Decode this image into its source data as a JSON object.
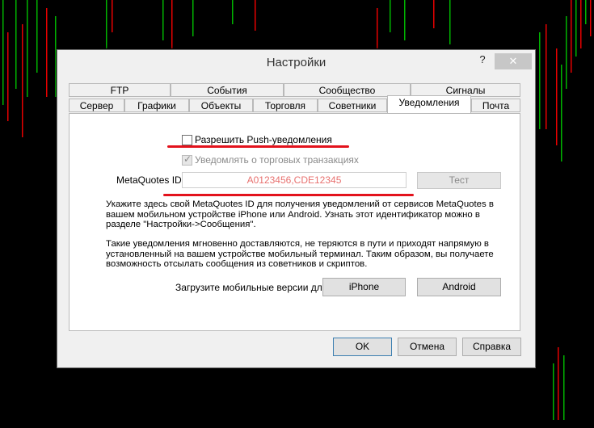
{
  "dialog": {
    "title": "Настройки",
    "help_label": "?",
    "close_label": "✕"
  },
  "tabs_row1": [
    "FTP",
    "События",
    "Сообщество",
    "Сигналы"
  ],
  "tabs_row2": [
    "Сервер",
    "Графики",
    "Объекты",
    "Торговля",
    "Советники",
    "Уведомления",
    "Почта"
  ],
  "notifications": {
    "enable_push_label": "Разрешить Push-уведомления",
    "enable_push_checked": false,
    "trade_notify_label": "Уведомлять о торговых транзакциях",
    "trade_notify_checked": true,
    "metaquotes_label": "MetaQuotes ID:",
    "metaquotes_value": "A0123456,CDE12345",
    "test_button": "Тест",
    "info_text_1": "Укажите здесь свой MetaQuotes ID для получения уведомлений от сервисов MetaQuotes в вашем мобильном устройстве iPhone или Android. Узнать этот идентификатор можно в разделе \"Настройки->Сообщения\".",
    "info_text_2": "Такие уведомления мгновенно доставляются, не теряются в пути и приходят напрямую в установленный на вашем устройстве мобильный терминал. Таким образом, вы получаете возможность отсылать сообщения из советников и скриптов.",
    "download_label": "Загрузите мобильные версии для:",
    "iphone_button": "iPhone",
    "android_button": "Android"
  },
  "footer": {
    "ok": "OK",
    "cancel": "Отмена",
    "help": "Справка"
  },
  "colors": {
    "bull": "#00b300",
    "bear": "#e60000",
    "highlight": "#e3121c"
  }
}
